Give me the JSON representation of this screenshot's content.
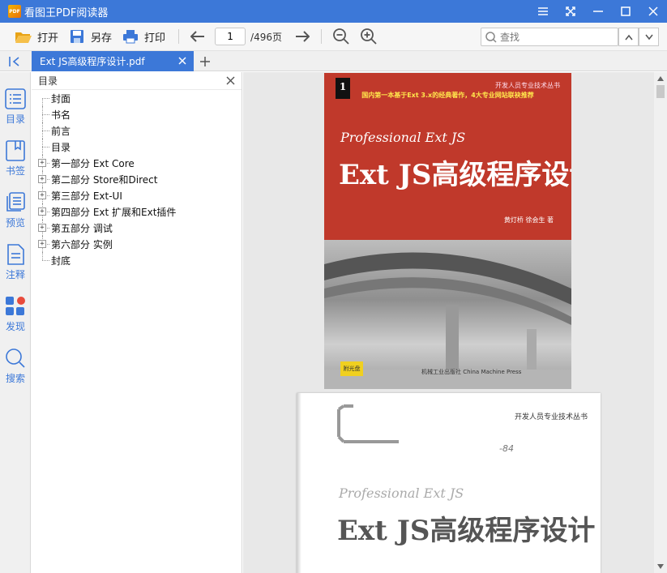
{
  "app": {
    "title": "看图王PDF阅读器",
    "logo_text": "PDF"
  },
  "toolbar": {
    "open_label": "打开",
    "save_as_label": "另存",
    "print_label": "打印",
    "current_page": "1",
    "total_pages": "/496页",
    "search_placeholder": "查找"
  },
  "tab": {
    "filename": "Ext JS高级程序设计.pdf"
  },
  "rail": {
    "items": [
      {
        "label": "目录"
      },
      {
        "label": "书签"
      },
      {
        "label": "预览"
      },
      {
        "label": "注释"
      },
      {
        "label": "发现"
      },
      {
        "label": "搜索"
      }
    ]
  },
  "toc": {
    "title": "目录",
    "items": [
      {
        "label": "封面",
        "expandable": false
      },
      {
        "label": "书名",
        "expandable": false
      },
      {
        "label": "前言",
        "expandable": false
      },
      {
        "label": "目录",
        "expandable": false
      },
      {
        "label": "第一部分 Ext Core",
        "expandable": true
      },
      {
        "label": "第二部分 Store和Direct",
        "expandable": true
      },
      {
        "label": "第三部分 Ext-UI",
        "expandable": true
      },
      {
        "label": "第四部分 Ext 扩展和Ext插件",
        "expandable": true
      },
      {
        "label": "第五部分 调试",
        "expandable": true
      },
      {
        "label": "第六部分 实例",
        "expandable": true
      },
      {
        "label": "封底",
        "expandable": false
      }
    ]
  },
  "pages": {
    "cover": {
      "series": "开发人员专业技术丛书",
      "banner": "国内第一本基于Ext 3.x的经典著作，4大专业网站联袂推荐",
      "title_en": "Professional Ext JS",
      "title_cn": "Ext JS高级程序设计",
      "authors": "黄灯桥  徐会生  著",
      "cd_label": "附光盘",
      "publisher": "机械工业出版社 China Machine Press"
    },
    "title_page": {
      "series": "开发人员专业技术丛书",
      "note": "-84",
      "title_en": "Professional Ext JS",
      "title_cn": "Ext JS高级程序设计"
    }
  },
  "colors": {
    "accent": "#3c78d8",
    "cover_red": "#c0392b",
    "cd_yellow": "#f0d020"
  }
}
